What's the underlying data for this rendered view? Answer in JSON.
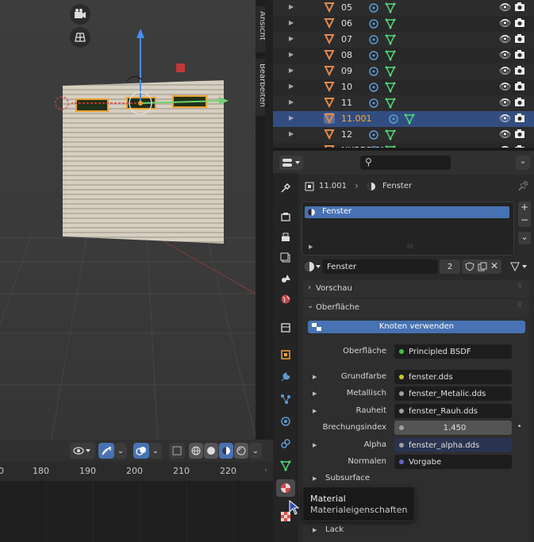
{
  "viewport": {
    "side_tabs": [
      "Ansicht",
      "Bearbeiten"
    ],
    "icons": [
      "camera-icon",
      "grid-view-icon"
    ]
  },
  "timeline": {
    "ticks": [
      "180",
      "190",
      "200",
      "210",
      "220"
    ],
    "left_partial": "0"
  },
  "outliner": {
    "rows": [
      {
        "name": "05"
      },
      {
        "name": "06"
      },
      {
        "name": "07"
      },
      {
        "name": "08"
      },
      {
        "name": "09"
      },
      {
        "name": "10"
      },
      {
        "name": "11"
      },
      {
        "name": "11.001"
      },
      {
        "name": "12"
      },
      {
        "name": "NURBS-Pfad"
      }
    ]
  },
  "properties": {
    "search_placeholder": "",
    "breadcrumb": {
      "object": "11.001",
      "material": "Fenster"
    },
    "slot_list": [
      "Fenster"
    ],
    "material_name": "Fenster",
    "users": "2",
    "sections": {
      "vorschau": "Vorschau",
      "oberflaeche": "Oberfläche",
      "subsurface": "Subsurface",
      "lack": "Lack"
    },
    "use_nodes_label": "Knoten verwenden",
    "fields": [
      {
        "label": "Oberfläche",
        "value": "Principled BSDF",
        "dot": "#3fbf3f"
      },
      {
        "label": "Grundfarbe",
        "value": "fenster.dds",
        "dot": "#c7c729"
      },
      {
        "label": "Metallisch",
        "value": "fenster_Metalic.dds",
        "dot": "#a1a1a1"
      },
      {
        "label": "Rauheit",
        "value": "fenster_Rauh.dds",
        "dot": "#a1a1a1"
      },
      {
        "label": "Brechungsindex",
        "value": "1.450",
        "dot": "#a1a1a1"
      },
      {
        "label": "Alpha",
        "value": "fenster_alpha.dds",
        "dot": "#a1a1a1"
      },
      {
        "label": "Normalen",
        "value": "Vorgabe",
        "dot": "#6363c7"
      }
    ]
  },
  "tooltip": {
    "title": "Material",
    "subtitle": "Materialeigenschaften"
  },
  "colors": {
    "accent": "#4772b3",
    "selected_row": "#334d80",
    "selected_text": "#ffaf29",
    "object_icon": "#e08a4c"
  }
}
